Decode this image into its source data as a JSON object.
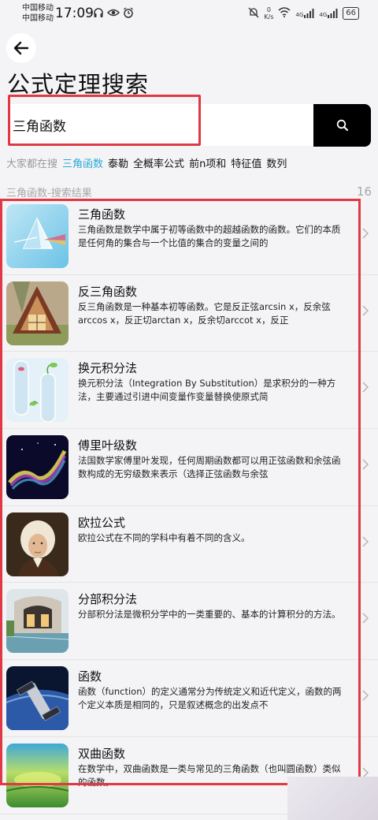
{
  "status_bar": {
    "carrier_1": "中国移动",
    "carrier_2": "中国移动",
    "time": "17:09",
    "speed_value": "0",
    "speed_unit": "K/s",
    "signal_1": "4G",
    "signal_2": "4G",
    "battery": "66"
  },
  "page": {
    "title": "公式定理搜索"
  },
  "search": {
    "value": "三角函数",
    "placeholder": ""
  },
  "hot": {
    "label": "大家都在搜",
    "tags": [
      "三角函数",
      "泰勒",
      "全概率公式",
      "前n项和",
      "特征值",
      "数列"
    ]
  },
  "results": {
    "header": "三角函数-搜索结果",
    "count": "16",
    "items": [
      {
        "title": "三角函数",
        "desc": "三角函数是数学中属于初等函数中的超越函数的函数。它们的本质是任何角的集合与一个比值的集合的变量之间的"
      },
      {
        "title": "反三角函数",
        "desc": "反三角函数是一种基本初等函数。它是反正弦arcsin x，反余弦arccos x，反正切arctan x，反余切arccot x，反正"
      },
      {
        "title": "换元积分法",
        "desc": "换元积分法（Integration By Substitution）是求积分的一种方法，主要通过引进中间变量作变量替换使原式简"
      },
      {
        "title": "傅里叶级数",
        "desc": "法国数学家傅里叶发现，任何周期函数都可以用正弦函数和余弦函数构成的无穷级数来表示（选择正弦函数与余弦"
      },
      {
        "title": "欧拉公式",
        "desc": "欧拉公式在不同的学科中有着不同的含义。"
      },
      {
        "title": "分部积分法",
        "desc": "分部积分法是微积分学中的一类重要的、基本的计算积分的方法。"
      },
      {
        "title": "函数",
        "desc": "函数（function）的定义通常分为传统定义和近代定义，函数的两个定义本质是相同的，只是叙述概念的出发点不"
      },
      {
        "title": "双曲函数",
        "desc": "在数学中，双曲函数是一类与常见的三角函数（也叫圆函数）类似的函数。"
      }
    ]
  }
}
